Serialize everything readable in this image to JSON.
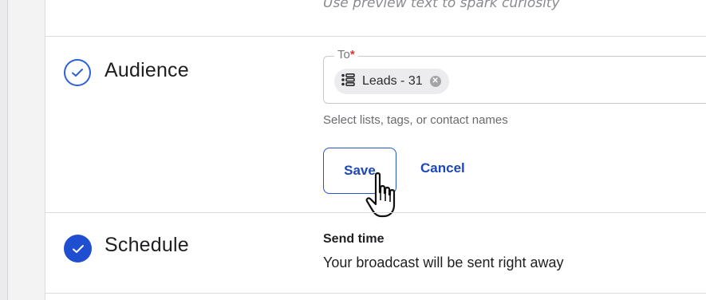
{
  "top_hint": "Use preview text to spark curiosity",
  "audience": {
    "title": "Audience",
    "to_label": "To",
    "required_mark": "*",
    "chip_label": "Leads - 31",
    "chip_icon": "list-icon",
    "helper": "Select lists, tags, or contact names",
    "save_label": "Save",
    "cancel_label": "Cancel"
  },
  "schedule": {
    "title": "Schedule",
    "send_time_label": "Send time",
    "send_time_value": "Your broadcast will be sent right away"
  },
  "colors": {
    "accent": "#1f4fd0",
    "required": "#e0322f"
  }
}
